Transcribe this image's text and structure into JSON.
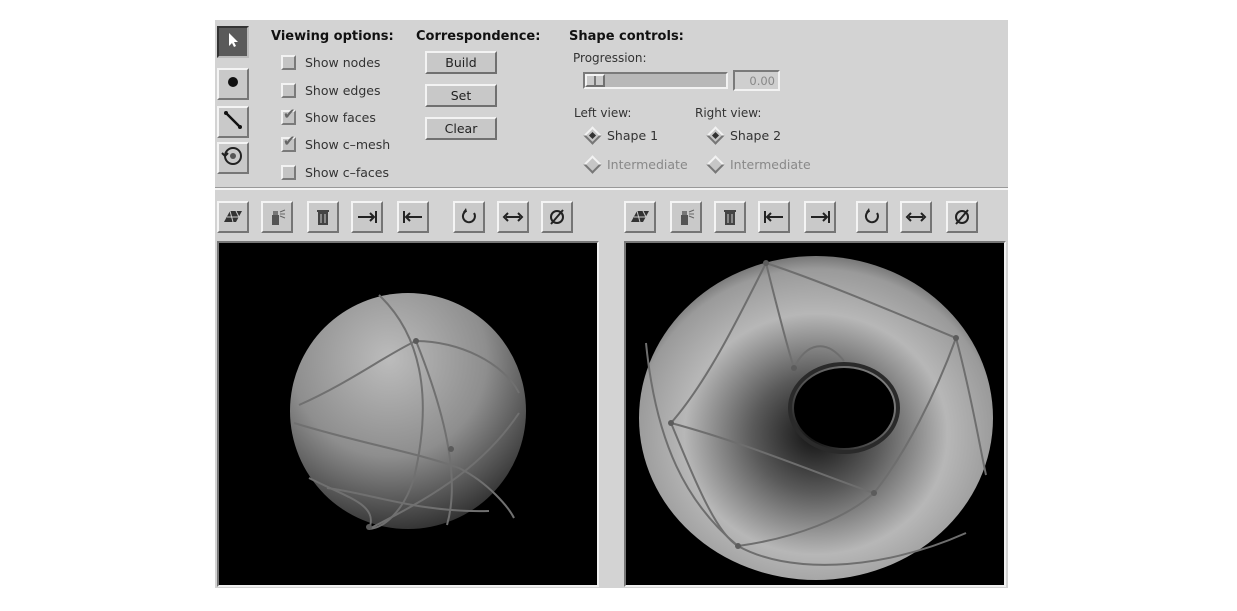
{
  "tools": [
    {
      "icon": "select-arrow-icon",
      "active": true
    },
    {
      "icon": "node-dot-icon",
      "active": false
    },
    {
      "icon": "edge-draw-icon",
      "active": false
    },
    {
      "icon": "rotate-view-icon",
      "active": false
    }
  ],
  "viewing_options": {
    "heading": "Viewing options:",
    "items": [
      {
        "label": "Show nodes",
        "checked": false
      },
      {
        "label": "Show edges",
        "checked": false
      },
      {
        "label": "Show faces",
        "checked": true
      },
      {
        "label": "Show c–mesh",
        "checked": true
      },
      {
        "label": "Show c–faces",
        "checked": false
      }
    ]
  },
  "correspondence": {
    "heading": "Correspondence:",
    "build_label": "Build",
    "set_label": "Set",
    "clear_label": "Clear"
  },
  "shape_controls": {
    "heading": "Shape controls:",
    "progression_label": "Progression:",
    "progression_value": "0.00",
    "progression_fraction": 0.0,
    "left_view": {
      "label": "Left view:",
      "options": [
        {
          "label": "Shape 1",
          "selected": true,
          "enabled": true
        },
        {
          "label": "Intermediate",
          "selected": false,
          "enabled": false
        }
      ]
    },
    "right_view": {
      "label": "Right view:",
      "options": [
        {
          "label": "Shape 2",
          "selected": true,
          "enabled": true
        },
        {
          "label": "Intermediate",
          "selected": false,
          "enabled": false
        }
      ]
    }
  },
  "left_toolbar": [
    "mesh-icon",
    "spray-icon",
    "trash-icon",
    "edge-right-icon",
    "edge-left-icon",
    "rotate-icon",
    "flip-icon",
    "clear-icon"
  ],
  "right_toolbar": [
    "mesh-icon",
    "spray-icon",
    "trash-icon",
    "edge-left-icon",
    "edge-right-icon",
    "rotate-icon",
    "flip-icon",
    "clear-icon"
  ],
  "colors": {
    "panel_bg": "#d3d3d3",
    "viewport_bg": "#000000",
    "surface_light": "#bdbdbd",
    "surface_dark": "#2e2e2e"
  }
}
